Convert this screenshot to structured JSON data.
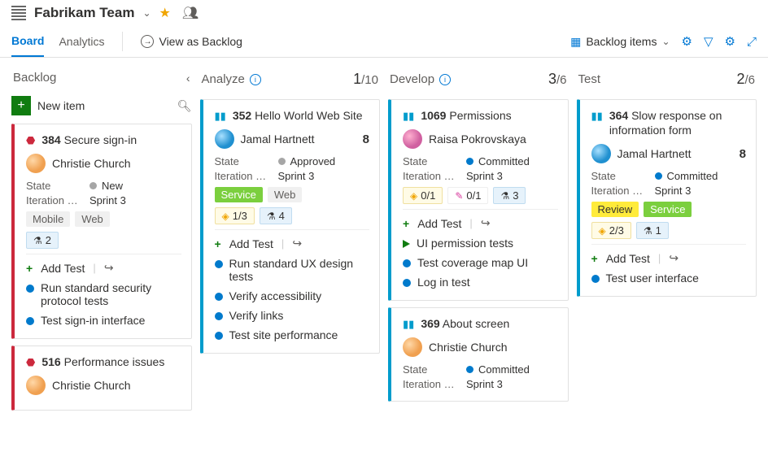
{
  "header": {
    "teamName": "Fabrikam Team"
  },
  "tabs": {
    "board": "Board",
    "analytics": "Analytics",
    "viewBacklog": "View as Backlog"
  },
  "toolbar": {
    "backlogItems": "Backlog items"
  },
  "columns": {
    "backlog": {
      "title": "Backlog",
      "newItem": "New item"
    },
    "analyze": {
      "title": "Analyze",
      "count": "1",
      "limit": "/10"
    },
    "develop": {
      "title": "Develop",
      "count": "3",
      "limit": "/6"
    },
    "test": {
      "title": "Test",
      "count": "2",
      "limit": "/6"
    }
  },
  "labels": {
    "state": "State",
    "iteration": "Iteration P...",
    "addTest": "Add Test"
  },
  "states": {
    "new": "New",
    "approved": "Approved",
    "committed": "Committed"
  },
  "sprint": "Sprint 3",
  "people": {
    "christie": "Christie Church",
    "jamal": "Jamal Hartnett",
    "raisa": "Raisa Pokrovskaya"
  },
  "tags": {
    "mobile": "Mobile",
    "web": "Web",
    "service": "Service",
    "review": "Review"
  },
  "cards": {
    "c384": {
      "id": "384",
      "title": "Secure sign-in",
      "flask": "2",
      "tests": [
        "Run standard security protocol tests",
        "Test sign-in interface"
      ]
    },
    "c516": {
      "id": "516",
      "title": "Performance issues"
    },
    "c352": {
      "id": "352",
      "title": "Hello World Web Site",
      "effort": "8",
      "check": "1/3",
      "flask": "4",
      "tests": [
        "Run standard UX design tests",
        "Verify accessibility",
        "Verify links",
        "Test site performance"
      ]
    },
    "c1069": {
      "id": "1069",
      "title": "Permissions",
      "check": "0/1",
      "pen": "0/1",
      "flask": "3",
      "tests": [
        "UI permission tests",
        "Test coverage map UI",
        "Log in test"
      ]
    },
    "c369": {
      "id": "369",
      "title": "About screen"
    },
    "c364": {
      "id": "364",
      "title": "Slow response on information form",
      "effort": "8",
      "check": "2/3",
      "flask": "1",
      "tests": [
        "Test user interface"
      ]
    }
  }
}
